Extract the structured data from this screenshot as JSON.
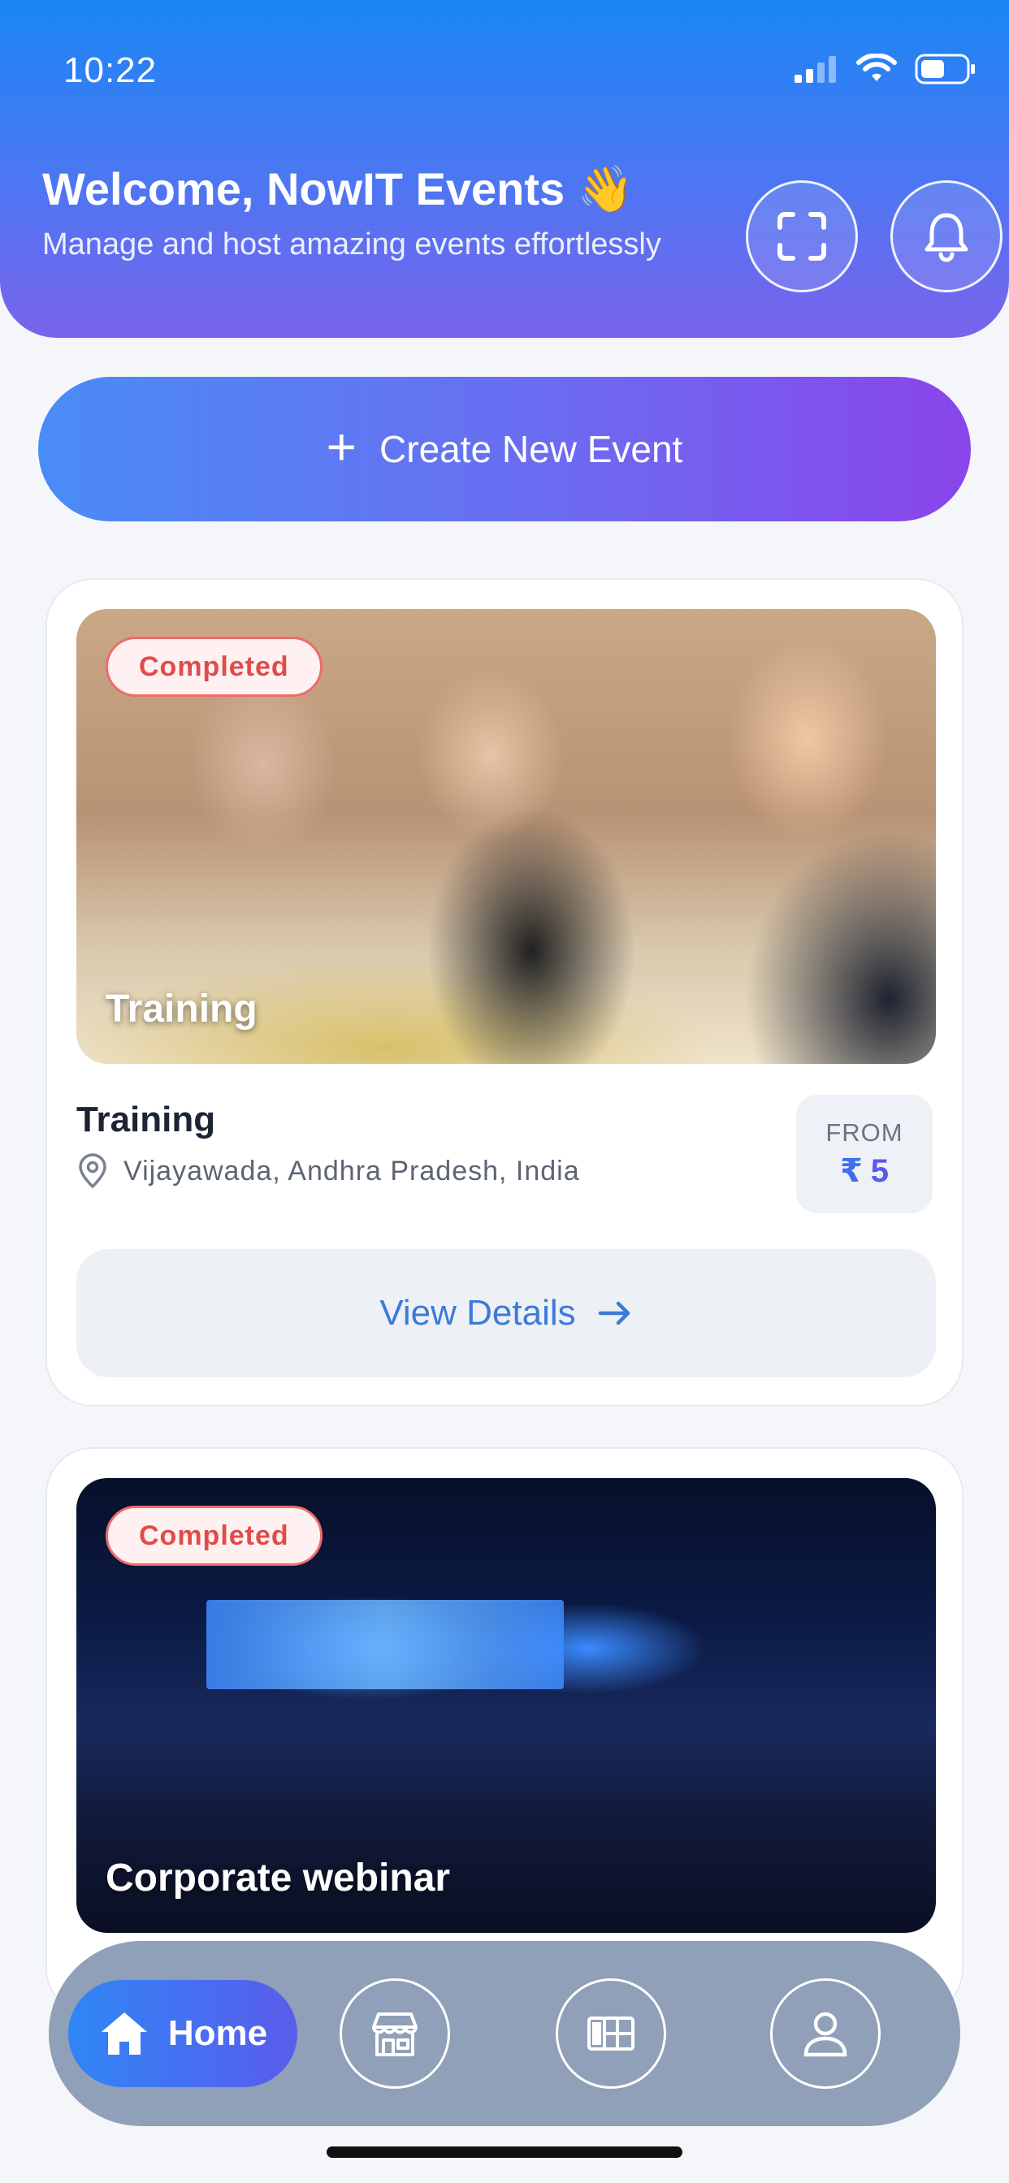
{
  "status_bar": {
    "time": "10:22"
  },
  "header": {
    "title": "Welcome, NowIT Events 👋",
    "subtitle": "Manage and host amazing events effortlessly",
    "scan_icon": "scan-icon",
    "bell_icon": "bell-icon"
  },
  "create_button": {
    "label": "Create New Event",
    "icon": "plus-icon"
  },
  "events": [
    {
      "status": "Completed",
      "image_label": "Training",
      "title": "Training",
      "location": "Vijayawada, Andhra Pradesh, India",
      "price_from_label": "FROM",
      "currency": "₹",
      "price": "5",
      "details_label": "View Details"
    },
    {
      "status": "Completed",
      "image_label": "Corporate webinar"
    }
  ],
  "nav": {
    "home_label": "Home",
    "items": [
      "home-icon",
      "store-icon",
      "grid-icon",
      "profile-icon"
    ]
  },
  "colors": {
    "header_top": "#1a86f5",
    "header_bottom": "#7a63ec",
    "badge_red": "#e04b4b",
    "accent_purple": "#5b59e8",
    "link_blue": "#3d7ad8",
    "nav_bg": "#8fa0b8"
  }
}
